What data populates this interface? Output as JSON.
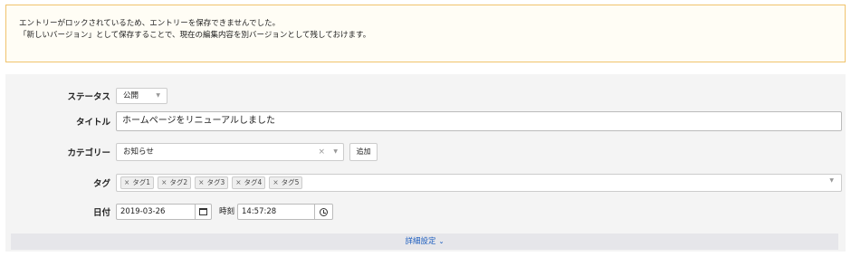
{
  "alert": {
    "line1": "エントリーがロックされているため、エントリーを保存できませんでした。",
    "line2": "「新しいバージョン」として保存することで、現在の編集内容を別バージョンとして残しておけます。"
  },
  "form": {
    "status": {
      "label": "ステータス",
      "value": "公開"
    },
    "title": {
      "label": "タイトル",
      "value": "ホームページをリニューアルしました"
    },
    "category": {
      "label": "カテゴリー",
      "value": "お知らせ",
      "clear_icon": "×",
      "add_label": "追加"
    },
    "tags": {
      "label": "タグ",
      "items": [
        "タグ1",
        "タグ2",
        "タグ3",
        "タグ4",
        "タグ5"
      ]
    },
    "date": {
      "label": "日付",
      "value": "2019-03-26",
      "time_label": "時刻",
      "time_value": "14:57:28"
    }
  },
  "details": {
    "label": "詳細設定",
    "icon": "chevron-down-icon"
  }
}
